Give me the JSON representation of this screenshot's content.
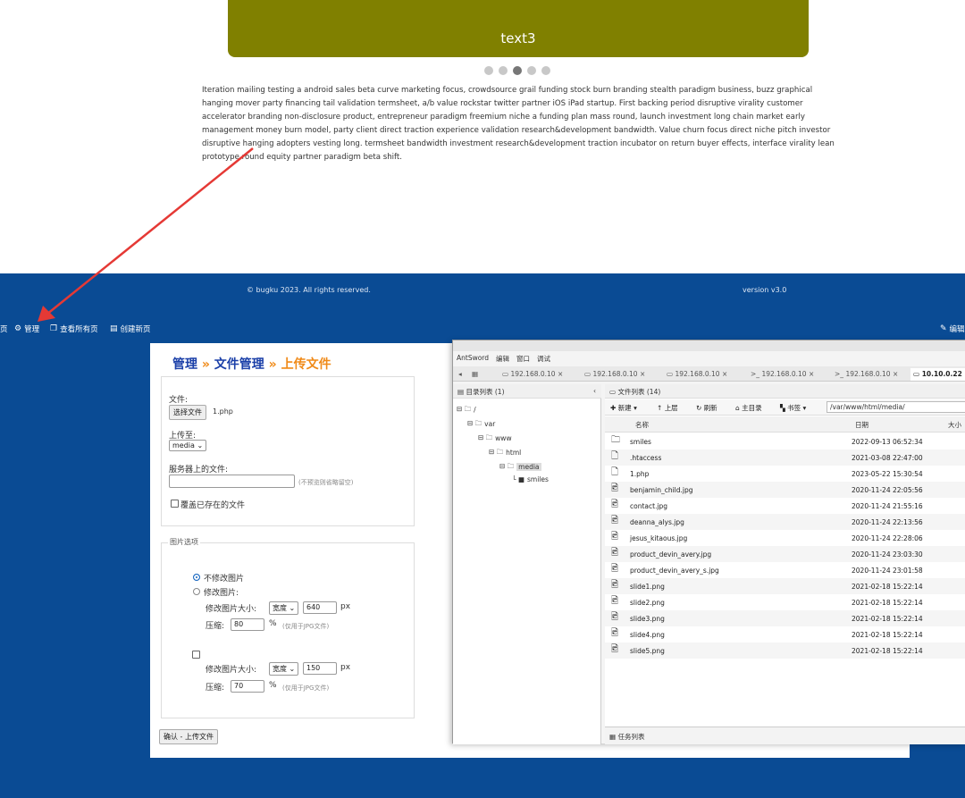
{
  "slide": {
    "text": "text3"
  },
  "paragraph": "Iteration mailing testing a android sales beta curve marketing focus, crowdsource grail funding stock burn branding stealth paradigm business, buzz graphical hanging mover party financing tail validation termsheet, a/b value rockstar twitter partner iOS iPad startup. First backing period disruptive virality customer accelerator branding non-disclosure product, entrepreneur paradigm freemium niche a funding plan mass round, launch investment long chain market early management money burn model, party client direct traction experience validation research&development bandwidth. Value churn focus direct niche pitch investor disruptive hanging adopters vesting long. termsheet bandwidth investment research&development traction incubator on return buyer effects, interface virality lean prototype round equity partner paradigm beta shift.",
  "footer": {
    "copyright": "© bugku 2023. All rights reserved.",
    "version": "version v3.0"
  },
  "adminbar": {
    "page": "页",
    "manage": "管理",
    "view_all": "查看所有页",
    "create": "创建新页",
    "edit": "编辑"
  },
  "upload": {
    "crumb_1": "管理",
    "sep": "»",
    "crumb_2": "文件管理",
    "crumb_3": "上传文件",
    "file_label": "文件:",
    "choose_button": "选择文件",
    "chosen_file": "1.php",
    "upload_to_label": "上传至:",
    "upload_to_value": "media",
    "server_file_label": "服务器上的文件:",
    "server_file_hint": "(不预览则省略留空)",
    "overwrite_label": "覆盖已存在的文件",
    "image_options_legend": "图片选项",
    "opt_no_change": "不修改图片",
    "opt_change": "修改图片:",
    "resize_label": "修改图片大小:",
    "width_option": "宽度",
    "size_value_1": "640",
    "px": "px",
    "compress_label": "压缩:",
    "compress_value_1": "80",
    "percent": "%",
    "compress_hint": "(仅用于JPG文件)",
    "size_value_2": "150",
    "compress_value_2": "70",
    "submit": "确认 - 上传文件"
  },
  "antsword": {
    "menu": [
      "AntSword",
      "编辑",
      "窗口",
      "调试"
    ],
    "tabs": [
      "192.168.0.10",
      "192.168.0.10",
      "192.168.0.10",
      "192.168.0.10",
      "192.168.0.10",
      "10.10.0.22"
    ],
    "dir_header": "目录列表 (1)",
    "tree": [
      "/",
      "var",
      "www",
      "html",
      "media",
      "smiles"
    ],
    "file_header": "文件列表 (14)",
    "toolbar": {
      "new": "新建",
      "up": "上层",
      "refresh": "刷新",
      "home": "主目录",
      "bookmark": "书签"
    },
    "path": "/var/www/html/media/",
    "columns": {
      "name": "名称",
      "date": "日期",
      "size": "大小"
    },
    "files": [
      {
        "icon": "folder-icon",
        "name": "smiles",
        "date": "2022-09-13 06:52:34"
      },
      {
        "icon": "file-icon",
        "name": ".htaccess",
        "date": "2021-03-08 22:47:00"
      },
      {
        "icon": "file-icon",
        "name": "1.php",
        "date": "2023-05-22 15:30:54"
      },
      {
        "icon": "image-file-icon",
        "name": "benjamin_child.jpg",
        "date": "2020-11-24 22:05:56"
      },
      {
        "icon": "image-file-icon",
        "name": "contact.jpg",
        "date": "2020-11-24 21:55:16"
      },
      {
        "icon": "image-file-icon",
        "name": "deanna_alys.jpg",
        "date": "2020-11-24 22:13:56"
      },
      {
        "icon": "image-file-icon",
        "name": "jesus_kitaous.jpg",
        "date": "2020-11-24 22:28:06"
      },
      {
        "icon": "image-file-icon",
        "name": "product_devin_avery.jpg",
        "date": "2020-11-24 23:03:30"
      },
      {
        "icon": "image-file-icon",
        "name": "product_devin_avery_s.jpg",
        "date": "2020-11-24 23:01:58"
      },
      {
        "icon": "image-file-icon",
        "name": "slide1.png",
        "date": "2021-02-18 15:22:14"
      },
      {
        "icon": "image-file-icon",
        "name": "slide2.png",
        "date": "2021-02-18 15:22:14"
      },
      {
        "icon": "image-file-icon",
        "name": "slide3.png",
        "date": "2021-02-18 15:22:14"
      },
      {
        "icon": "image-file-icon",
        "name": "slide4.png",
        "date": "2021-02-18 15:22:14"
      },
      {
        "icon": "image-file-icon",
        "name": "slide5.png",
        "date": "2021-02-18 15:22:14"
      }
    ],
    "status": "任务列表"
  },
  "colors": {
    "band": "#0a4b94",
    "slide": "#808000",
    "crumb_blue": "#1a3fa8",
    "crumb_orange": "#f08a18",
    "arrow": "#e53935"
  }
}
